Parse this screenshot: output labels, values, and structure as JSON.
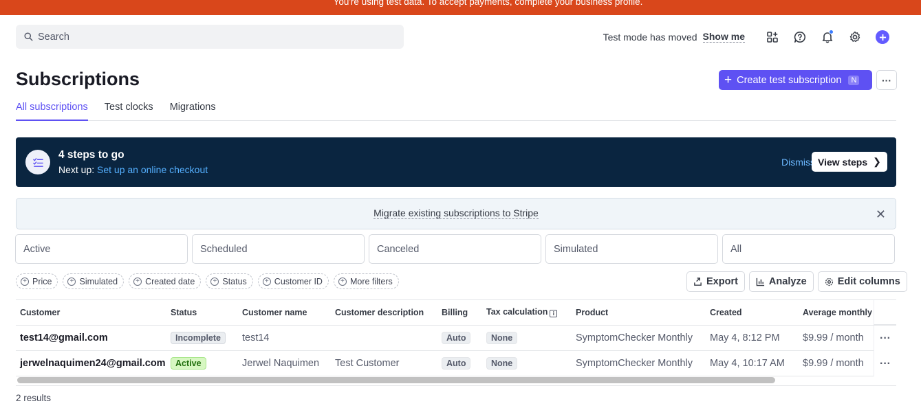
{
  "banner": {
    "text": "You're using test data. To accept payments, complete your business profile."
  },
  "search": {
    "placeholder": "Search"
  },
  "topbar": {
    "test_mode_text": "Test mode has moved",
    "show_me": "Show me"
  },
  "page": {
    "title": "Subscriptions"
  },
  "buttons": {
    "create": "Create test subscription",
    "create_shortcut": "N",
    "more": "···"
  },
  "tabs": [
    {
      "label": "All subscriptions",
      "active": true
    },
    {
      "label": "Test clocks",
      "active": false
    },
    {
      "label": "Migrations",
      "active": false
    }
  ],
  "steps": {
    "title": "4 steps to go",
    "next_prefix": "Next up:",
    "next_link": "Set up an online checkout",
    "dismiss": "Dismiss",
    "view": "View steps"
  },
  "migrate": {
    "text": "Migrate existing subscriptions to Stripe"
  },
  "status_cards": [
    "Active",
    "Scheduled",
    "Canceled",
    "Simulated",
    "All"
  ],
  "filters": [
    "Price",
    "Simulated",
    "Created date",
    "Status",
    "Customer ID",
    "More filters"
  ],
  "actions": {
    "export": "Export",
    "analyze": "Analyze",
    "edit_columns": "Edit columns"
  },
  "table": {
    "columns": [
      "Customer",
      "Status",
      "Customer name",
      "Customer description",
      "Billing",
      "Tax calculation",
      "Product",
      "Created",
      "Average monthly"
    ],
    "rows": [
      {
        "customer": "test14@gmail.com",
        "status": "Incomplete",
        "name": "test14",
        "description": "",
        "billing": "Auto",
        "tax": "None",
        "product": "SymptomChecker Monthly",
        "created": "May 4, 8:12 PM",
        "avg": "$9.99 / month"
      },
      {
        "customer": "jerwelnaquimen24@gmail.com",
        "status": "Active",
        "name": "Jerwel Naquimen",
        "description": "Test Customer",
        "billing": "Auto",
        "tax": "None",
        "product": "SymptomChecker Monthly",
        "created": "May 4, 10:17 AM",
        "avg": "$9.99 / month"
      }
    ]
  },
  "results": "2 results",
  "colors": {
    "accent": "#5e51f3",
    "banner": "#d9471b",
    "steps_bg": "#0a2540"
  }
}
